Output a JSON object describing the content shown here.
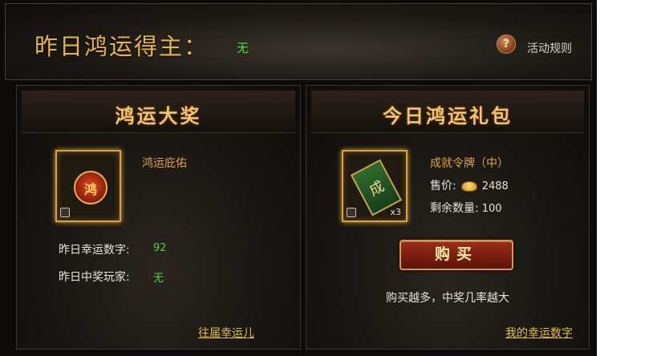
{
  "header": {
    "title": "昨日鸿运得主：",
    "winner": "无",
    "help_icon": "?",
    "rules_link": "活动规则"
  },
  "grand_prize": {
    "title": "鸿运大奖",
    "item_name": "鸿运庇佑",
    "lucky_number_label": "昨日幸运数字:",
    "lucky_number_value": "92",
    "winner_label": "昨日中奖玩家:",
    "winner_value": "无",
    "history_link": "往届幸运儿"
  },
  "daily_pack": {
    "title": "今日鸿运礼包",
    "item_name": "成就令牌（中）",
    "quantity": "x3",
    "price_label": "售价:",
    "price_value": "2488",
    "remaining_label": "剩余数量:",
    "remaining_value": "100",
    "buy_button": "购买",
    "hint": "购买越多，中奖几率越大",
    "my_numbers_link": "我的幸运数字"
  },
  "colors": {
    "gold": "#e7b640",
    "green": "#4fd83b",
    "button": "#9b2d1c"
  },
  "icons": [
    "help-icon",
    "lock-icon",
    "coin-icon"
  ]
}
